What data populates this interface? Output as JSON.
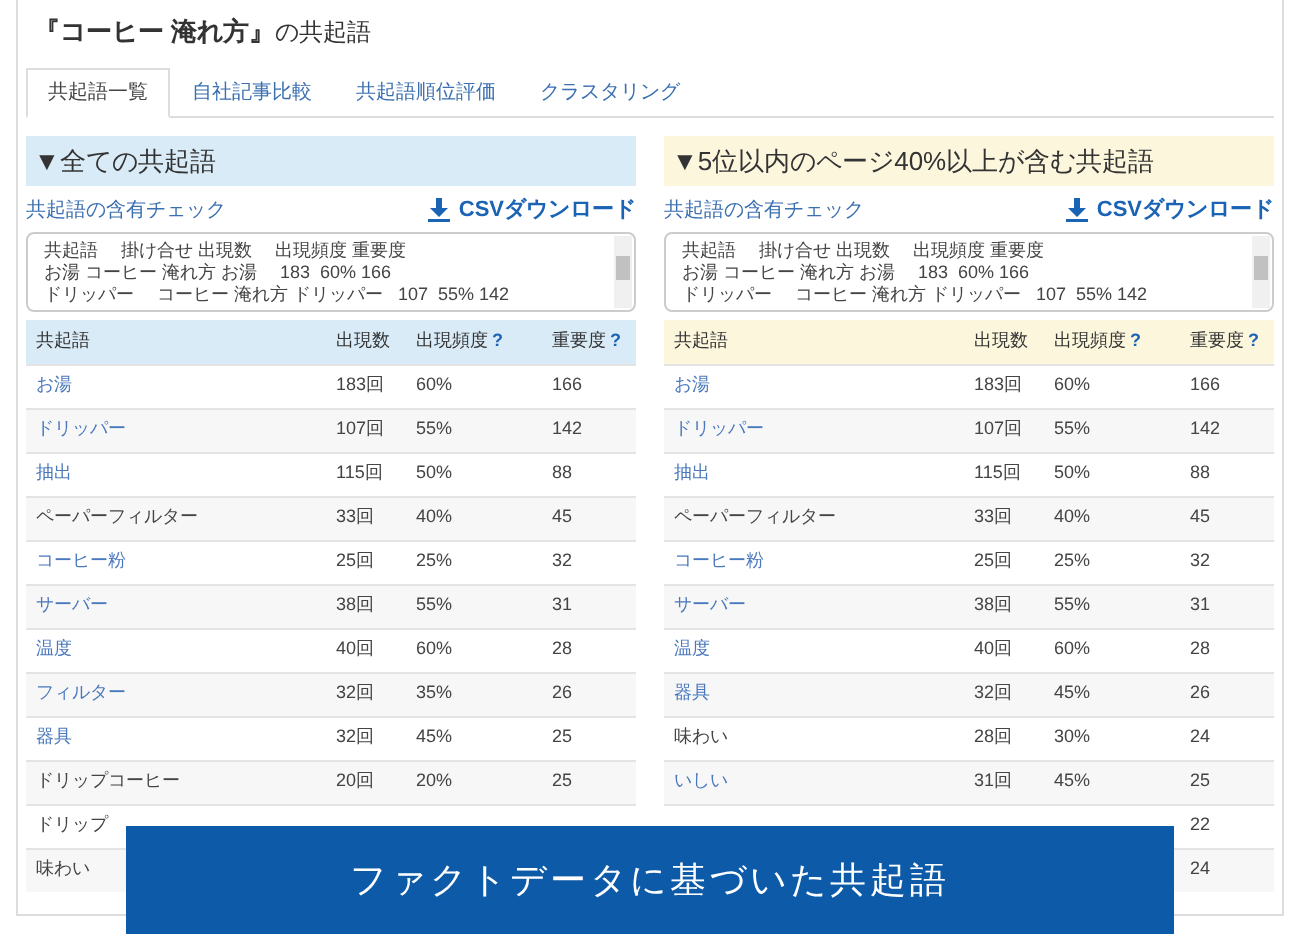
{
  "title": {
    "quote": "『コーヒー 淹れ方』",
    "suffix": "の共起語"
  },
  "tabs": [
    {
      "label": "共起語一覧",
      "selected": true
    },
    {
      "label": "自社記事比較",
      "selected": false
    },
    {
      "label": "共起語順位評価",
      "selected": false
    },
    {
      "label": "クラスタリング",
      "selected": false
    }
  ],
  "panels": [
    {
      "heading": "▼全ての共起語",
      "color": "#d9ebf7",
      "check_link": "共起語の含有チェック",
      "csv_button": "CSVダウンロード",
      "csv_lines": [
        "共起語　 掛け合せ 出現数　 出現頻度 重要度",
        "お湯 コーヒー 淹れ方 お湯　 183  60% 166",
        "ドリッパー　 コーヒー 淹れ方 ドリッパー   107  55% 142"
      ],
      "columns": [
        "共起語",
        "出現数",
        "出現頻度",
        "重要度"
      ],
      "help_mark": "?",
      "rows": [
        {
          "word": "お湯",
          "linked": true,
          "count": "183回",
          "freq": "60%",
          "score": "166"
        },
        {
          "word": "ドリッパー",
          "linked": true,
          "count": "107回",
          "freq": "55%",
          "score": "142"
        },
        {
          "word": "抽出",
          "linked": true,
          "count": "115回",
          "freq": "50%",
          "score": "88"
        },
        {
          "word": "ペーパーフィルター",
          "linked": false,
          "count": "33回",
          "freq": "40%",
          "score": "45"
        },
        {
          "word": "コーヒー粉",
          "linked": true,
          "count": "25回",
          "freq": "25%",
          "score": "32"
        },
        {
          "word": "サーバー",
          "linked": true,
          "count": "38回",
          "freq": "55%",
          "score": "31"
        },
        {
          "word": "温度",
          "linked": true,
          "count": "40回",
          "freq": "60%",
          "score": "28"
        },
        {
          "word": "フィルター",
          "linked": true,
          "count": "32回",
          "freq": "35%",
          "score": "26"
        },
        {
          "word": "器具",
          "linked": true,
          "count": "32回",
          "freq": "45%",
          "score": "25"
        },
        {
          "word": "ドリップコーヒー",
          "linked": false,
          "count": "20回",
          "freq": "20%",
          "score": "25"
        },
        {
          "word": "ドリップ",
          "linked": false
        },
        {
          "word": "味わい",
          "linked": false
        }
      ]
    },
    {
      "heading": "▼5位以内のページ40%以上が含む共起語",
      "color": "#fcf6dd",
      "check_link": "共起語の含有チェック",
      "csv_button": "CSVダウンロード",
      "csv_lines": [
        "共起語　 掛け合せ 出現数　 出現頻度 重要度",
        "お湯 コーヒー 淹れ方 お湯　 183  60% 166",
        "ドリッパー　 コーヒー 淹れ方 ドリッパー   107  55% 142"
      ],
      "columns": [
        "共起語",
        "出現数",
        "出現頻度",
        "重要度"
      ],
      "help_mark": "?",
      "rows": [
        {
          "word": "お湯",
          "linked": true,
          "count": "183回",
          "freq": "60%",
          "score": "166"
        },
        {
          "word": "ドリッパー",
          "linked": true,
          "count": "107回",
          "freq": "55%",
          "score": "142"
        },
        {
          "word": "抽出",
          "linked": true,
          "count": "115回",
          "freq": "50%",
          "score": "88"
        },
        {
          "word": "ペーパーフィルター",
          "linked": false,
          "count": "33回",
          "freq": "40%",
          "score": "45"
        },
        {
          "word": "コーヒー粉",
          "linked": true,
          "count": "25回",
          "freq": "25%",
          "score": "32"
        },
        {
          "word": "サーバー",
          "linked": true,
          "count": "38回",
          "freq": "55%",
          "score": "31"
        },
        {
          "word": "温度",
          "linked": true,
          "count": "40回",
          "freq": "60%",
          "score": "28"
        },
        {
          "word": "器具",
          "linked": true,
          "count": "32回",
          "freq": "45%",
          "score": "26"
        },
        {
          "word": "味わい",
          "linked": false,
          "count": "28回",
          "freq": "30%",
          "score": "24"
        },
        {
          "word": "いしい",
          "linked": true,
          "count": "31回",
          "freq": "45%",
          "score": "25"
        },
        {
          "score": "22"
        },
        {
          "score": "24"
        }
      ]
    }
  ],
  "banner": "ファクトデータに基づいた共起語"
}
